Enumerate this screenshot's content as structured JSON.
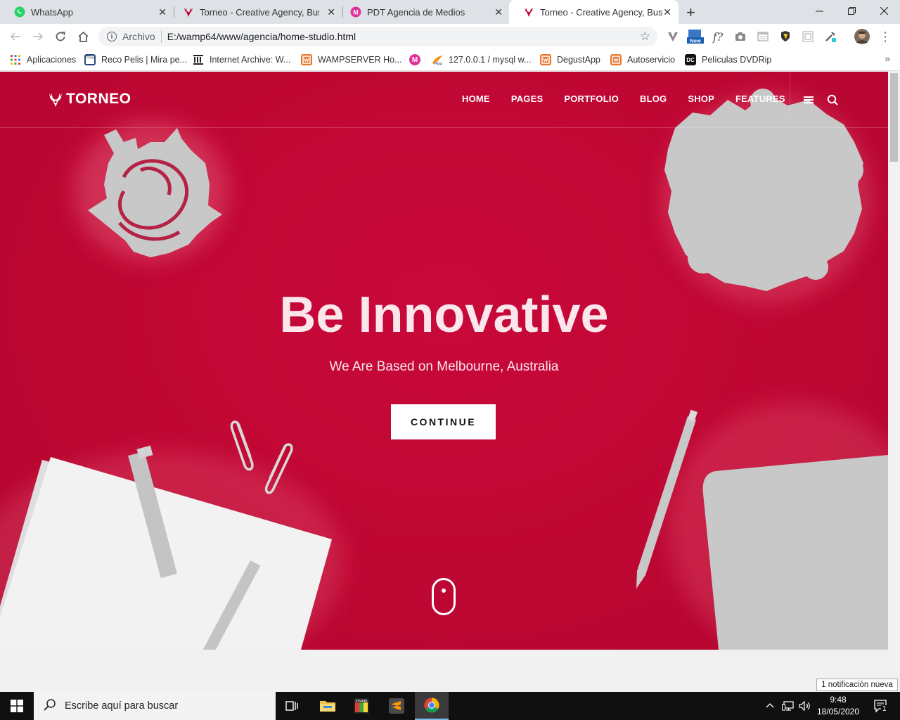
{
  "browser": {
    "tabs": [
      {
        "title": "WhatsApp",
        "icon": "whatsapp-icon",
        "active": false
      },
      {
        "title": "Torneo - Creative Agency, Busine",
        "icon": "deer-icon",
        "active": false
      },
      {
        "title": "PDT Agencia de Medios",
        "icon": "pdt-icon",
        "active": false
      },
      {
        "title": "Torneo - Creative Agency, Busine",
        "icon": "deer-icon",
        "active": true
      }
    ],
    "new_tab": "+",
    "address": {
      "scheme": "Archivo",
      "url": "E:/wamp64/www/agencia/home-studio.html"
    },
    "bookmarks": [
      {
        "label": "Aplicaciones",
        "icon": "apps-grid-icon"
      },
      {
        "label": "Reco Pelis | Mira pe...",
        "icon": "clapper-icon"
      },
      {
        "label": "Internet Archive: W...",
        "icon": "archive-icon"
      },
      {
        "label": "WAMPSERVER Ho...",
        "icon": "wamp-icon"
      },
      {
        "label": "",
        "icon": "pdt-icon"
      },
      {
        "label": "127.0.0.1 / mysql w...",
        "icon": "phpmyadmin-icon"
      },
      {
        "label": "DegustApp",
        "icon": "wamp-icon"
      },
      {
        "label": "Autoservicio",
        "icon": "wamp-icon"
      },
      {
        "label": "Películas DVDRip",
        "icon": "dc-icon"
      }
    ],
    "more": "»"
  },
  "site": {
    "logo": "TORNEO",
    "menu": [
      "HOME",
      "PAGES",
      "PORTFOLIO",
      "BLOG",
      "SHOP",
      "FEATURES"
    ],
    "hero": {
      "headline": "Be Innovative",
      "subline": "We Are Based on Melbourne, Australia",
      "cta": "CONTINUE"
    },
    "colors": {
      "accent": "#c00733",
      "text_light": "#fbe6ec"
    }
  },
  "notification_toast": "1 notificación nueva",
  "taskbar": {
    "search_placeholder": "Escribe aquí para buscar",
    "time": "9:48",
    "date": "18/05/2020",
    "notification_count": "1"
  }
}
